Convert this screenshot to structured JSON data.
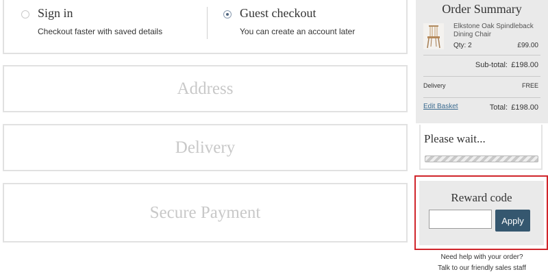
{
  "login": {
    "sign_in_title": "Sign in",
    "sign_in_sub": "Checkout faster with saved details",
    "guest_title": "Guest checkout",
    "guest_sub": "You can create an account later",
    "selected": "guest"
  },
  "steps": [
    {
      "label": "Address"
    },
    {
      "label": "Delivery"
    },
    {
      "label": "Secure Payment"
    }
  ],
  "summary": {
    "title": "Order Summary",
    "product": {
      "name": "Elkstone Oak Spindleback Dining Chair",
      "qty": "Qty: 2",
      "price": "£99.00",
      "image_icon": "chair-image"
    },
    "subtotal_label": "Sub-total:",
    "subtotal_value": "£198.00",
    "delivery_label": "Delivery",
    "delivery_value": "FREE",
    "edit_basket": "Edit Basket",
    "total_label": "Total:",
    "total_value": "£198.00"
  },
  "wait": {
    "title": "Please wait..."
  },
  "reward": {
    "title": "Reward code",
    "input_value": "",
    "apply_label": "Apply",
    "highlight_color": "#d0242a"
  },
  "help": {
    "line1": "Need help with your order?",
    "line2": "Talk to our friendly sales staff"
  },
  "colors": {
    "apply_bg": "#35576f",
    "panel_border": "#e1e1e1",
    "summary_bg": "#eaeaea",
    "link": "#3a6a8f"
  }
}
